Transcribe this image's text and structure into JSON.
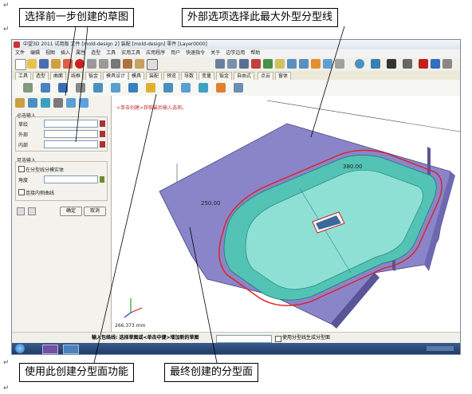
{
  "window": {
    "title": "中望3D 2011 试用版   文件 [mold-design 2] 装配 [mold-design]  零件 [Layer0000]",
    "menus": [
      "文件",
      "编辑",
      "视图",
      "插入",
      "属性",
      "造型",
      "工具",
      "实用工具",
      "应用程序",
      "用户",
      "快速指令",
      "关于",
      "边学边用",
      "帮助"
    ]
  },
  "tabs": [
    "工具",
    "造型",
    "曲面",
    "线框",
    "钣金",
    "模具设计",
    "模具",
    "装配",
    "预览",
    "导数",
    "变量",
    "钣金",
    "自由式",
    "点云",
    "窗体"
  ],
  "active_tab": "模具设计",
  "panel": {
    "section_required": "必选输入",
    "label_sketch": "草绘",
    "label_outer": "外部",
    "label_inner": "内部",
    "section_optional": "可选输入",
    "opt_split_surface": "在分型线分模实体",
    "label_degree": "角度",
    "opt_split_inner": "连接内侧曲线",
    "ok": "确定",
    "cancel": "取消"
  },
  "viewport": {
    "hint": "<单击创建>获取最后输入选项。",
    "dim_top": "380.00",
    "dim_left": "250.00",
    "length_readout": "266.373 mm"
  },
  "status": {
    "prompt": "输入包络线: 选择草图或<单击中键>增加新的草图",
    "check_label": "使用分型线生成分型面"
  },
  "callouts": {
    "top_left": "选择前一步创建的草图",
    "top_right": "外部选项选择此最大外型分型线",
    "bottom_left": "使用此创建分型面功能",
    "bottom_right": "最终创建的分型面"
  },
  "para_mark": "↵",
  "colors": {
    "flange": "#8a85c9",
    "flange_dark": "#6d68b0",
    "body": "#52c3b4",
    "body_light": "#8fe0d4",
    "parting_line": "#e02020"
  }
}
